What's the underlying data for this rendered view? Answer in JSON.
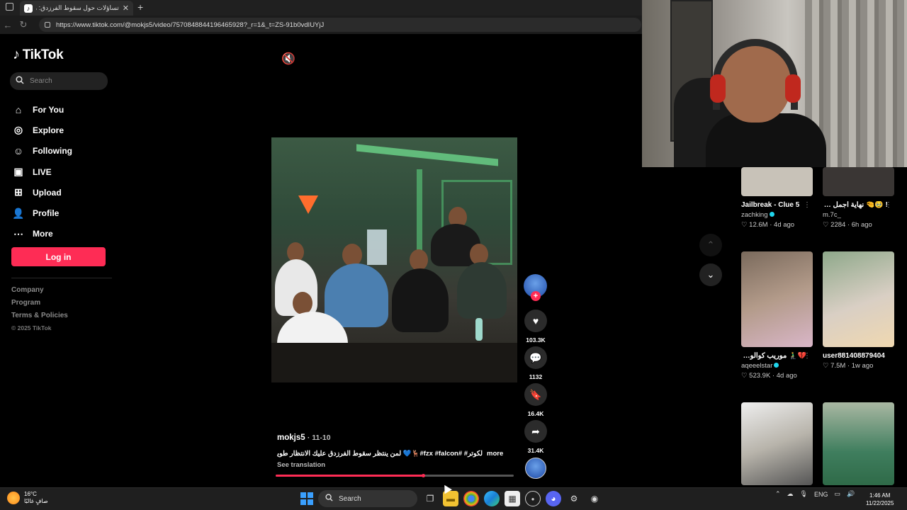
{
  "browser": {
    "tab_title": "تساؤلات حول سقوط الفرزدق: هل ...",
    "url": "https://www.tiktok.com/@mokjs5/video/7570848844196465928?_r=1&_t=ZS-91b0vdIUYjJ"
  },
  "sidebar": {
    "logo": "TikTok",
    "search_placeholder": "Search",
    "items": [
      {
        "label": "For You",
        "icon": "home-icon"
      },
      {
        "label": "Explore",
        "icon": "compass-icon"
      },
      {
        "label": "Following",
        "icon": "user-follow-icon"
      },
      {
        "label": "LIVE",
        "icon": "live-icon"
      },
      {
        "label": "Upload",
        "icon": "plus-square-icon"
      },
      {
        "label": "Profile",
        "icon": "person-icon"
      },
      {
        "label": "More",
        "icon": "more-dots-icon"
      }
    ],
    "login_label": "Log in",
    "footer": {
      "company": "Company",
      "program": "Program",
      "terms": "Terms & Policies",
      "copyright": "© 2025 TikTok"
    }
  },
  "video": {
    "author": "mokjs5",
    "date": "11-10",
    "caption": "لكوتر# #fzx #falcon#🦌💙 لمن ينتظر سقوط الفرزدق عليك الانتظار طويلا ...",
    "more_label": "more",
    "see_translation": "See translation",
    "progress": 0.62,
    "actions": {
      "likes": "103.3K",
      "comments": "1132",
      "saves": "16.4K",
      "shares": "31.4K"
    }
  },
  "feed": [
    {
      "title": "Jailbreak - Clue 5",
      "user": "zachking",
      "verified": true,
      "likes": "12.6M",
      "age": "4d ago",
      "color": "#c8c2b8"
    },
    {
      "title": "! 🥹🤏 نهاية اجمل فترة كلام ابو عبير و رايس D...",
      "user": "m.7c_",
      "verified": false,
      "likes": "2284",
      "age": "6h ago",
      "color": "#3a3634"
    },
    {
      "title": "💔🧎‍♂️ موريب كوالوش الرايسي_#عقيل...",
      "user": "aqeeelstar",
      "verified": true,
      "likes": "523.9K",
      "age": "4d ago",
      "color": "#b39b8a"
    },
    {
      "title": "",
      "user": "user881408879404",
      "verified": false,
      "likes": "7.5M",
      "age": "1w ago",
      "color": "#d9cfc4"
    },
    {
      "title": "",
      "user": "",
      "verified": false,
      "likes": "",
      "age": "",
      "color": "#b8b4ab"
    },
    {
      "title": "",
      "user": "",
      "verified": false,
      "likes": "",
      "age": "",
      "color": "#3f7e5e"
    }
  ],
  "taskbar": {
    "weather_temp": "16°C",
    "weather_desc": "صافٍ غالبًا",
    "search_label": "Search",
    "language": "ENG",
    "time": "1:46 AM",
    "date": "11/22/2025"
  }
}
